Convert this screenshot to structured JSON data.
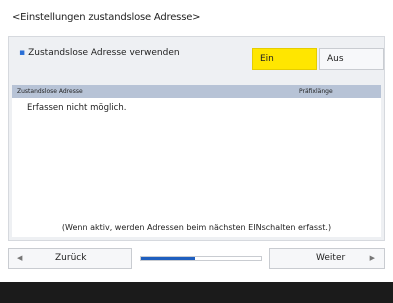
{
  "screen_title": "<Einstellungen zustandslose Adresse>",
  "setting": {
    "label": "Zustandslose Adresse verwenden",
    "on_label": "Ein",
    "off_label": "Aus",
    "selected": "Ein"
  },
  "address_list": {
    "columns": [
      "Zustandslose Adresse",
      "Präfixlänge"
    ],
    "message": "Erfassen nicht möglich.",
    "note": "(Wenn aktiv, werden Adressen beim nächsten EINschalten erfasst.)"
  },
  "navigation": {
    "back_label": "Zurück",
    "next_label": "Weiter",
    "scroll_position": 0.45
  },
  "colors": {
    "selected_toggle": "#ffe600",
    "list_header": "#b7c3d6",
    "progress": "#1f5fbf",
    "bottom_bar": "#1b1b1b"
  }
}
